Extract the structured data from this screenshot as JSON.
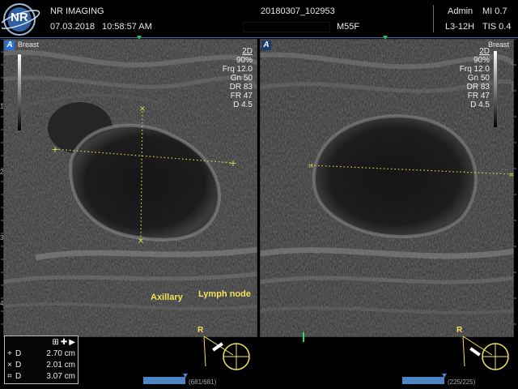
{
  "header": {
    "institution": "NR IMAGING",
    "date": "07.03.2018",
    "time": "10:58:57 AM",
    "study_id": "20180307_102953",
    "patient_tag": "M55F",
    "user": "Admin",
    "mi": "MI 0.7",
    "probe": "L3-12H",
    "tis": "TIS 0.4",
    "logo_text": "NR"
  },
  "panes": [
    {
      "label": "Breast",
      "mode": "2D",
      "params": [
        "90%",
        "Frq 12.0",
        "Gn 50",
        "DR 83",
        "FR 47",
        "D 4.5"
      ],
      "active": true
    },
    {
      "label": "Breast",
      "mode": "2D",
      "params": [
        "90%",
        "Frq 12.0",
        "Gn 50",
        "DR 83",
        "FR 47",
        "D 4.5"
      ],
      "active": false
    }
  ],
  "depth_ticks": [
    "1",
    "2",
    "3",
    "4"
  ],
  "annotations": {
    "axillary": "Axillary",
    "lymph_node": "Lymph node"
  },
  "measurements": {
    "toolbar": [
      "⊞",
      "✚",
      "▶"
    ],
    "rows": [
      {
        "symbol": "+",
        "label": "D",
        "value": "2.70 cm"
      },
      {
        "symbol": "×",
        "label": "D",
        "value": "2.01 cm"
      },
      {
        "symbol": "⌗",
        "label": "D",
        "value": "3.07 cm"
      }
    ]
  },
  "probe_marker": "R",
  "cine": [
    {
      "text": "(681/681)",
      "fraction": 1.0
    },
    {
      "text": "(225/225)",
      "fraction": 1.0
    }
  ],
  "colors": {
    "caliper": "#e5d94a",
    "accent": "#2a6fd1",
    "annotation": "#f5e15a"
  }
}
